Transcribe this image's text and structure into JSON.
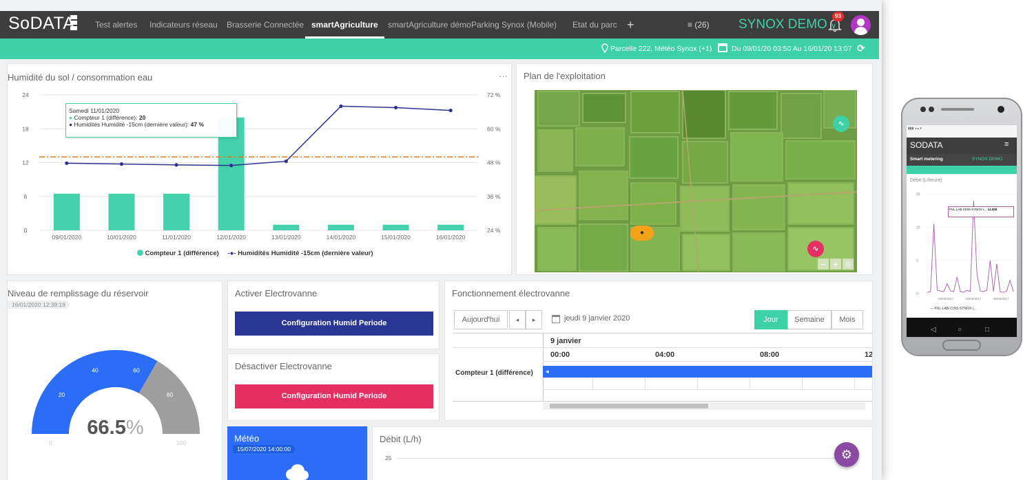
{
  "app": {
    "logo": "SoDATA",
    "tabs": [
      {
        "label": "Test alertes"
      },
      {
        "label": "Indicateurs réseau"
      },
      {
        "label": "Brasserie Connectée"
      },
      {
        "label": "smartAgriculture"
      },
      {
        "label": "smartAgriculture démo"
      },
      {
        "label": "Parking Synox (Mobile)"
      },
      {
        "label": "Etat du parc"
      }
    ],
    "add_tab": "+",
    "menu_count": "≡ (26)",
    "account": "SYNOX DEMO",
    "notification_count": "93"
  },
  "subbar": {
    "location": "Parcelle 222, Météo Synox (+1)",
    "date_range": "Du 09/01/20 03:50 Au 16/01/20 13:07"
  },
  "soil_card": {
    "title": "Humidité du sol / consommation eau",
    "menu": "···",
    "tooltip": {
      "date": "Samedi 11/01/2020",
      "line1_label": "Compteur 1 (différence):",
      "line1_value": "20",
      "line2_label": "Humidités Humidité -15cm (dernière valeur):",
      "line2_value": "47 %"
    }
  },
  "chart_data": {
    "type": "bar",
    "categories": [
      "09/01/2020",
      "10/01/2020",
      "11/01/2020",
      "12/01/2020",
      "13/01/2020",
      "14/01/2020",
      "15/01/2020",
      "16/01/2020"
    ],
    "series": [
      {
        "name": "Compteur 1 (différence)",
        "type": "bar",
        "axis": "left",
        "values": [
          6.5,
          6.5,
          6.5,
          20,
          1,
          1,
          1,
          1
        ],
        "color": "#44d1ac"
      },
      {
        "name": "Humidités Humidité -15cm (dernière valeur)",
        "type": "line",
        "axis": "right",
        "values": [
          47.8,
          47.5,
          47.2,
          47,
          48.5,
          68,
          67.5,
          66.5
        ],
        "color": "#2e3192"
      }
    ],
    "threshold": {
      "value": 13,
      "axis": "left",
      "color": "#e07b1f"
    },
    "y_left": {
      "ticks": [
        "0",
        "6",
        "12",
        "18",
        "24"
      ],
      "ylim": [
        0,
        24
      ]
    },
    "y_right": {
      "ticks": [
        "24 %",
        "36 %",
        "48 %",
        "60 %",
        "72 %"
      ],
      "ylim": [
        24,
        72
      ]
    },
    "legend": "bottom",
    "grid": true
  },
  "map_card": {
    "title": "Plan de l'exploitation"
  },
  "tank_card": {
    "title": "Niveau de remplissage du réservoir",
    "timestamp": "16/01/2020 12:39:19",
    "gauge": {
      "value": 66.5,
      "display": "66.5",
      "unit": "%",
      "ticks": [
        "0",
        "20",
        "40",
        "60",
        "80",
        "100"
      ],
      "fill_color": "#2b6ef5",
      "rest_color": "#9e9e9e"
    }
  },
  "activate_card": {
    "title": "Activer Electrovanne",
    "button": "Configuration Humid Periode"
  },
  "deactivate_card": {
    "title": "Désactiver Electrovanne",
    "button": "Configuration Humid Periode"
  },
  "timeline_card": {
    "title": "Fonctionnement électrovanne",
    "today": "Aujourd'hui",
    "prev": "◂",
    "next": "▸",
    "date": "jeudi 9 janvier 2020",
    "views": [
      "Jour",
      "Semaine",
      "Mois"
    ],
    "day": "9 janvier",
    "hours": [
      "00:00",
      "04:00",
      "08:00",
      "12"
    ],
    "row": "Compteur 1 (différence)"
  },
  "meteo_card": {
    "title": "Météo",
    "timestamp": "15/07/2020 14:00:00"
  },
  "debit_card": {
    "title": "Débit (L/h)",
    "tick": "25"
  },
  "phone": {
    "logo": "SODATA",
    "tab": "Smart metering",
    "account": "SYNOX DEMO",
    "chart_title": "Débit (L/heure)",
    "legend": "PUL-LAB-21NS SYNOX (...",
    "y_ticks": [
      "15",
      "10",
      "5",
      "0"
    ],
    "x_ticks": [
      "26/05/2017",
      "28/05/2017",
      "30/05/2017"
    ],
    "tooltip": "PUL LAB 21NS SYNOX (...",
    "tooltip_value": "14.000"
  }
}
